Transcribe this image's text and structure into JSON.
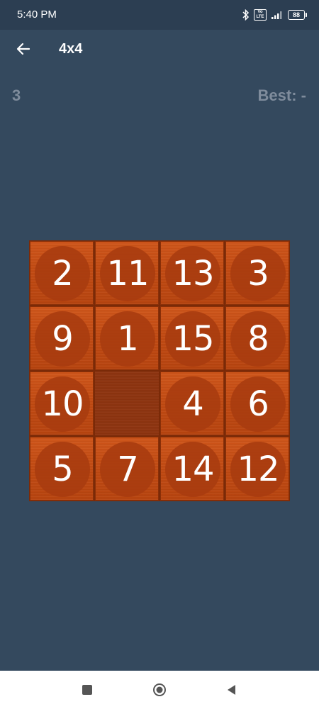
{
  "status": {
    "time": "5:40 PM",
    "battery": "88",
    "volte": "Vo LTE"
  },
  "app_bar": {
    "title": "4x4"
  },
  "score": {
    "moves": "3",
    "best": "Best: -"
  },
  "board": {
    "size": 4,
    "tiles": [
      2,
      11,
      13,
      3,
      9,
      1,
      15,
      8,
      10,
      null,
      4,
      6,
      5,
      7,
      14,
      12
    ]
  },
  "colors": {
    "background": "#34495e",
    "tile": "#c24a12",
    "tile_disc": "#a83c10",
    "empty": "#8e3410"
  }
}
